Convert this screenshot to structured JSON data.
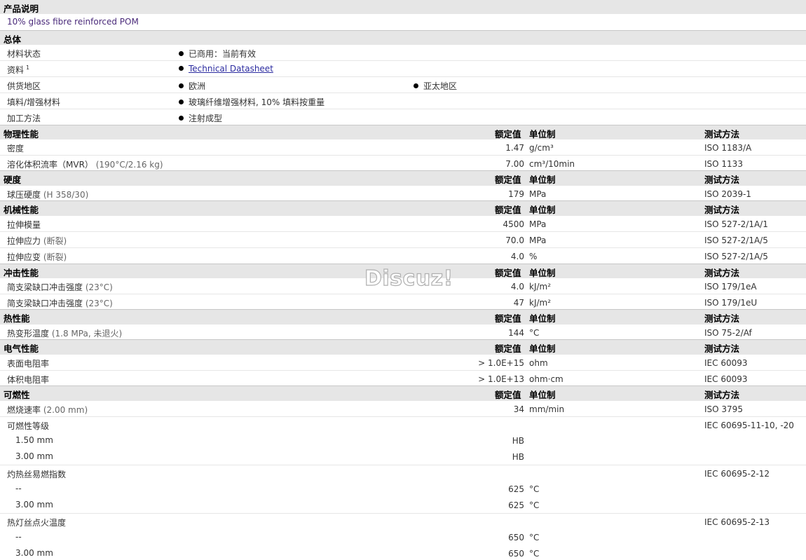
{
  "description": {
    "title": "产品说明",
    "text": "10% glass fibre reinforced POM"
  },
  "overview": {
    "title": "总体",
    "rows": [
      {
        "label": "材料状态",
        "items": [
          "已商用：当前有效"
        ]
      },
      {
        "label": "资料",
        "sup": "1",
        "items": [
          "Technical Datasheet"
        ]
      },
      {
        "label": "供货地区",
        "items": [
          "欧洲",
          "亚太地区"
        ]
      },
      {
        "label": "填料/增强材料",
        "items": [
          "玻璃纤维增强材料, 10% 填料按重量"
        ]
      },
      {
        "label": "加工方法",
        "items": [
          "注射成型"
        ]
      }
    ]
  },
  "headers": {
    "value": "额定值",
    "unit": "单位制",
    "method": "测试方法"
  },
  "sections": {
    "physical": {
      "title": "物理性能",
      "rows": [
        {
          "label": "密度",
          "value": "1.47",
          "unit": "g/cm³",
          "method": "ISO 1183/A"
        },
        {
          "label": "溶化体积流率（MVR）",
          "cond": "(190°C/2.16 kg)",
          "value": "7.00",
          "unit": "cm³/10min",
          "method": "ISO 1133"
        }
      ]
    },
    "hardness": {
      "title": "硬度",
      "rows": [
        {
          "label": "球压硬度",
          "cond": "(H 358/30)",
          "value": "179",
          "unit": "MPa",
          "method": "ISO 2039-1"
        }
      ]
    },
    "mechanical": {
      "title": "机械性能",
      "rows": [
        {
          "label": "拉伸模量",
          "value": "4500",
          "unit": "MPa",
          "method": "ISO 527-2/1A/1"
        },
        {
          "label": "拉伸应力",
          "cond": "(断裂)",
          "value": "70.0",
          "unit": "MPa",
          "method": "ISO 527-2/1A/5"
        },
        {
          "label": "拉伸应变",
          "cond": "(断裂)",
          "value": "4.0",
          "unit": "%",
          "method": "ISO 527-2/1A/5"
        }
      ]
    },
    "impact": {
      "title": "冲击性能",
      "rows": [
        {
          "label": "简支梁缺口冲击强度",
          "cond": "(23°C)",
          "value": "4.0",
          "unit": "kJ/m²",
          "method": "ISO 179/1eA"
        },
        {
          "label": "简支梁缺口冲击强度",
          "cond": "(23°C)",
          "value": "47",
          "unit": "kJ/m²",
          "method": "ISO 179/1eU"
        }
      ]
    },
    "thermal": {
      "title": "热性能",
      "rows": [
        {
          "label": "热变形温度",
          "cond": "(1.8 MPa, 未退火)",
          "value": "144",
          "unit": "°C",
          "method": "ISO 75-2/Af"
        }
      ]
    },
    "electrical": {
      "title": "电气性能",
      "rows": [
        {
          "label": "表面电阻率",
          "value": "> 1.0E+15",
          "unit": "ohm",
          "method": "IEC 60093"
        },
        {
          "label": "体积电阻率",
          "value": "> 1.0E+13",
          "unit": "ohm·cm",
          "method": "IEC 60093"
        }
      ]
    },
    "flammability": {
      "title": "可燃性",
      "rows": [
        {
          "label": "燃烧速率",
          "cond": "(2.00 mm)",
          "value": "34",
          "unit": "mm/min",
          "method": "ISO 3795"
        },
        {
          "label": "可燃性等级",
          "method": "IEC 60695-11-10, -20"
        },
        {
          "label": "1.50 mm",
          "value": "HB"
        },
        {
          "label": "3.00 mm",
          "value": "HB"
        },
        {
          "label": "灼热丝易燃指数",
          "method": "IEC 60695-2-12"
        },
        {
          "label": "--",
          "value": "625",
          "unit": "°C"
        },
        {
          "label": "3.00 mm",
          "value": "625",
          "unit": "°C"
        },
        {
          "label": "热灯丝点火温度",
          "method": "IEC 60695-2-13"
        },
        {
          "label": "--",
          "value": "650",
          "unit": "°C"
        },
        {
          "label": "3.00 mm",
          "value": "650",
          "unit": "°C"
        }
      ]
    }
  },
  "watermark": "Discuz!"
}
